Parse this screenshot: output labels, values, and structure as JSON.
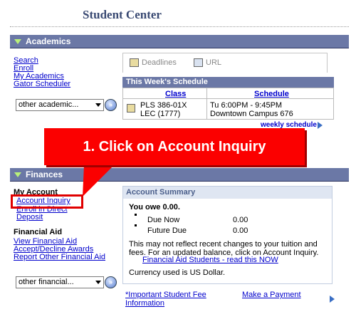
{
  "page_title": "Student Center",
  "academics": {
    "title": "Academics",
    "links": [
      "Search",
      "Enroll",
      "My Academics",
      "Gator Scheduler"
    ],
    "dropdown": "other academic...",
    "go_symbol": "»",
    "tabs": [
      {
        "label": "Deadlines",
        "icon": "calendar-icon"
      },
      {
        "label": "URL",
        "icon": "url-icon"
      }
    ],
    "schedule": {
      "title": "This Week's Schedule",
      "columns": [
        "Class",
        "Schedule"
      ],
      "rows": [
        {
          "class_line1": "PLS 386-01X",
          "class_line2": "LEC (1777)",
          "schedule_line1": "Tu 6:00PM - 9:45PM",
          "schedule_line2": "Downtown Campus 676"
        }
      ],
      "weekly_link": "weekly schedule"
    }
  },
  "callout": {
    "text": "1. Click on Account Inquiry",
    "color": "#fb0000"
  },
  "finances": {
    "title": "Finances",
    "my_account": {
      "heading": "My Account",
      "links": [
        "Account Inquiry",
        "Enroll in Direct",
        "Deposit"
      ]
    },
    "financial_aid": {
      "heading": "Financial Aid",
      "links": [
        "View Financial Aid",
        "Accept/Decline Awards",
        "Report Other Financial Aid"
      ]
    },
    "dropdown": "other financial...",
    "go_symbol": "»",
    "account_summary": {
      "title": "Account Summary",
      "owe_text": "You owe 0.00.",
      "items": [
        {
          "label": "Due Now",
          "amount": "0.00"
        },
        {
          "label": "Future Due",
          "amount": "0.00"
        }
      ],
      "notice_line1": "This may not reflect recent changes to your tuition and",
      "notice_line2": "fees.  For an updated balance, click on Account Inquiry.",
      "fa_link": "Financial Aid Students - read this NOW",
      "currency": "Currency used is US Dollar."
    },
    "fee_link_line1": "*Important Student Fee",
    "fee_link_line2": "Information",
    "payment_link": "Make a Payment"
  }
}
